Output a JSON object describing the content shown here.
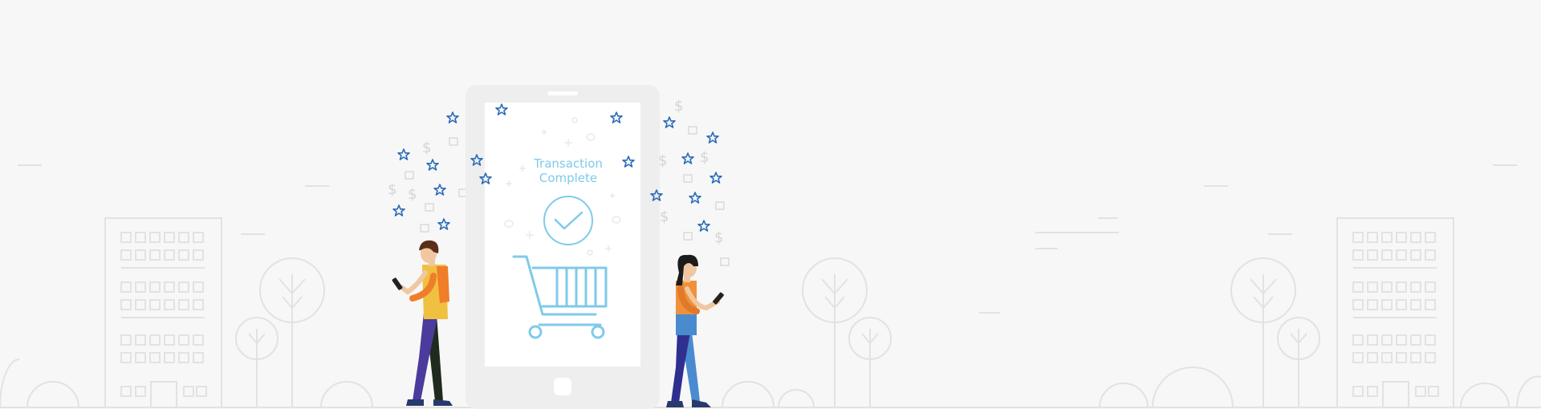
{
  "hero": {
    "title_line1": "Transaction",
    "title_line2": "Complete"
  },
  "colors": {
    "background": "#f7f7f7",
    "accent_blue": "#7fcaea",
    "star_blue": "#2b6bb8",
    "phone_body": "#eeeeee",
    "line_art": "#e2e2e2",
    "person_man_shirt": "#f0c040",
    "person_woman_shirt": "#f0903a"
  },
  "icons": [
    "star-icon",
    "dollar-icon",
    "thumbs-up-icon",
    "check-circle-icon",
    "shopping-cart-icon",
    "phone-home-button-icon"
  ]
}
